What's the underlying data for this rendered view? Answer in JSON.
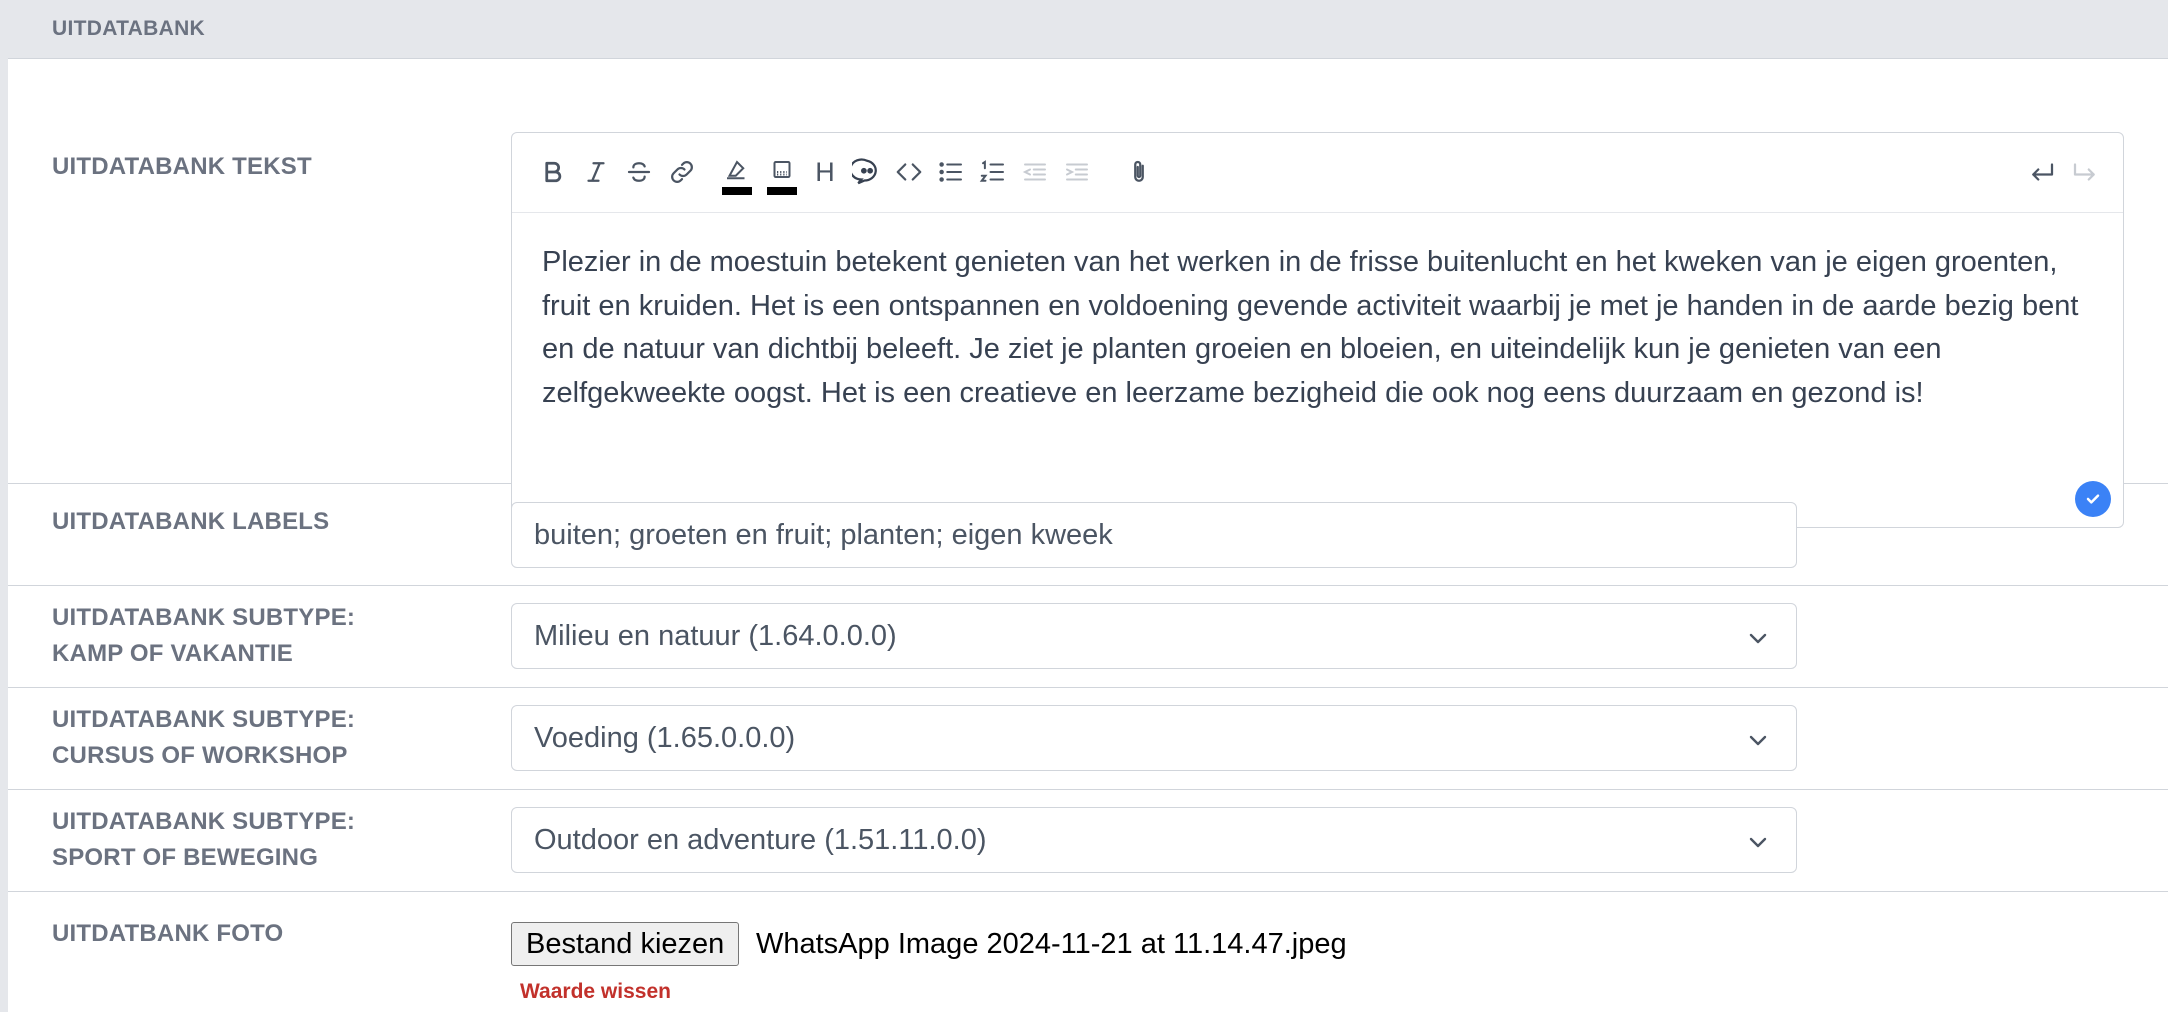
{
  "section": {
    "title": "UITDATABANK"
  },
  "text_field": {
    "label": "UITDATABANK TEKST",
    "toolbar": [
      "bold-icon",
      "italic-icon",
      "strikethrough-icon",
      "link-icon",
      "text-color-icon",
      "background-color-icon",
      "heading-icon",
      "quote-icon",
      "code-icon",
      "bullet-list-icon",
      "numbered-list-icon",
      "outdent-icon",
      "indent-icon",
      "attachment-icon",
      "undo-icon",
      "redo-icon"
    ],
    "heading_glyph": "H",
    "content": "Plezier in de moestuin betekent genieten van het werken in de frisse buitenlucht en het kweken van je eigen groenten, fruit en kruiden. Het is een ontspannen en voldoening gevende activiteit waarbij je met je handen in de aarde bezig bent en de natuur van dichtbij beleeft. Je ziet je planten groeien en bloeien, en uiteindelijk kun je genieten van een zelfgekweekte oogst. Het is een creatieve en leerzame bezigheid die ook nog eens duurzaam en gezond is!",
    "status_color": "#3b82f6"
  },
  "labels_field": {
    "label": "UITDATABANK LABELS",
    "value": "buiten; groeten en fruit; planten; eigen kweek"
  },
  "subtype_camp": {
    "label_line1": "UITDATABANK SUBTYPE:",
    "label_line2": "KAMP OF VAKANTIE",
    "selected": "Milieu en natuur (1.64.0.0.0)"
  },
  "subtype_course": {
    "label_line1": "UITDATABANK SUBTYPE:",
    "label_line2": "CURSUS OF WORKSHOP",
    "selected": "Voeding (1.65.0.0.0)"
  },
  "subtype_sport": {
    "label_line1": "UITDATABANK SUBTYPE:",
    "label_line2": "SPORT OF BEWEGING",
    "selected": "Outdoor en adventure (1.51.11.0.0)"
  },
  "photo_field": {
    "label": "UITDATBANK FOTO",
    "button": "Bestand kiezen",
    "file_name": "WhatsApp Image 2024-11-21 at 11.14.47.jpeg",
    "clear": "Waarde wissen",
    "clear_color": "#c2312b"
  }
}
